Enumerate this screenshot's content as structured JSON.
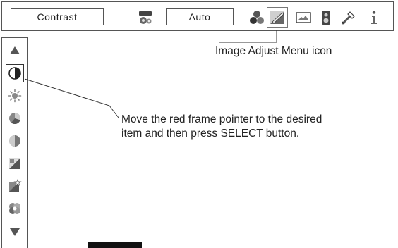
{
  "menu_bar": {
    "item_name": "Contrast",
    "item_value": "Auto",
    "icons": [
      {
        "name": "pc-adjust-icon"
      },
      {
        "name": "image-select-icon"
      },
      {
        "name": "image-adjust-icon",
        "selected": true
      },
      {
        "name": "screen-icon"
      },
      {
        "name": "sound-icon"
      },
      {
        "name": "setting-icon"
      },
      {
        "name": "information-icon"
      }
    ]
  },
  "sidebar": {
    "items": [
      {
        "name": "scroll-up-icon"
      },
      {
        "name": "contrast-icon",
        "active": true
      },
      {
        "name": "brightness-icon"
      },
      {
        "name": "color-icon"
      },
      {
        "name": "tint-icon"
      },
      {
        "name": "color-temp-icon"
      },
      {
        "name": "white-balance-icon"
      },
      {
        "name": "gamma-icon"
      },
      {
        "name": "scroll-down-icon"
      }
    ]
  },
  "annotations": {
    "menu_icon_callout": "Image Adjust Menu icon",
    "pointer_callout_line1": "Move the red frame pointer to the desired",
    "pointer_callout_line2": "item and then press SELECT button."
  }
}
